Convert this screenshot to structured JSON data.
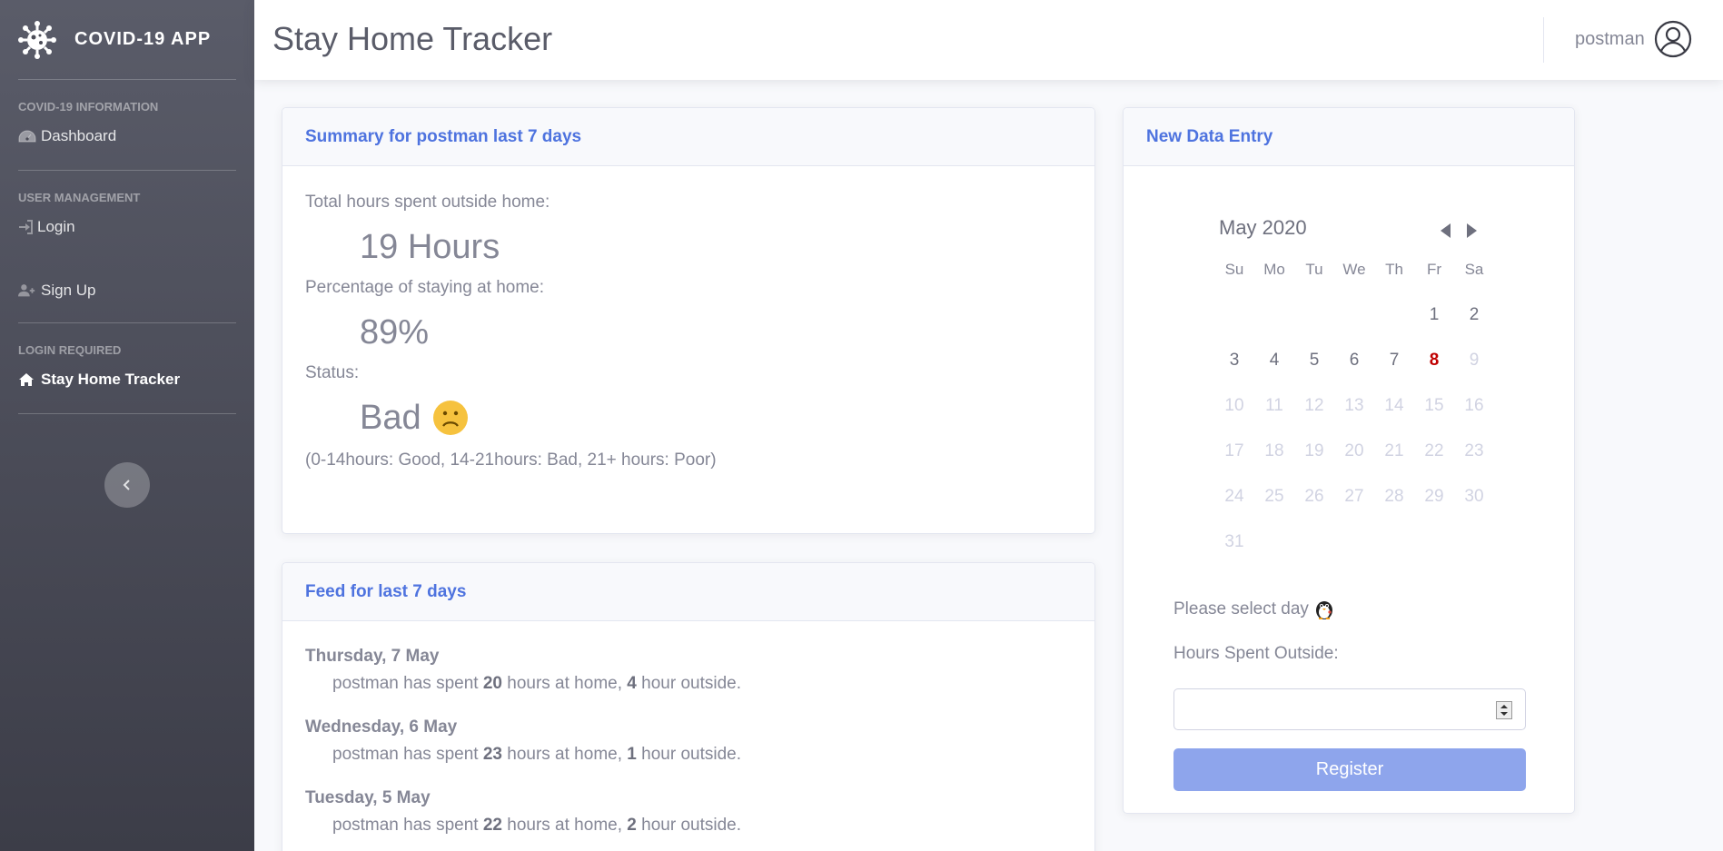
{
  "sidebar": {
    "brand": "COVID-19 APP",
    "sections": [
      {
        "heading": "COVID-19 INFORMATION",
        "items": [
          {
            "label": "Dashboard",
            "icon": "dashboard-icon"
          }
        ]
      },
      {
        "heading": "USER MANAGEMENT",
        "items": [
          {
            "label": "Login",
            "icon": "sign-in-icon"
          },
          {
            "label": "Sign Up",
            "icon": "user-plus-icon"
          }
        ]
      },
      {
        "heading": "LOGIN REQUIRED",
        "items": [
          {
            "label": "Stay Home Tracker",
            "icon": "home-icon",
            "active": true
          }
        ]
      }
    ]
  },
  "topbar": {
    "title": "Stay Home Tracker",
    "username": "postman"
  },
  "summary": {
    "header": "Summary for postman last 7 days",
    "hours_label": "Total hours spent outside home:",
    "hours_value": "19 Hours",
    "pct_label": "Percentage of staying at home:",
    "pct_value": "89%",
    "status_label": "Status:",
    "status_value": "Bad",
    "legend": "(0-14hours: Good, 14-21hours: Bad, 21+ hours: Poor)"
  },
  "feed": {
    "header": "Feed for last 7 days",
    "entries": [
      {
        "day": "Thursday, 7 May",
        "prefix": "postman has spent",
        "home": "20",
        "mid": "hours at home,",
        "outside": "4",
        "suffix": "hour outside."
      },
      {
        "day": "Wednesday, 6 May",
        "prefix": "postman has spent",
        "home": "23",
        "mid": "hours at home,",
        "outside": "1",
        "suffix": "hour outside."
      },
      {
        "day": "Tuesday, 5 May",
        "prefix": "postman has spent",
        "home": "22",
        "mid": "hours at home,",
        "outside": "2",
        "suffix": "hour outside."
      }
    ]
  },
  "entry": {
    "header": "New Data Entry",
    "calendar": {
      "month_label": "May 2020",
      "weekdays": [
        "Su",
        "Mo",
        "Tu",
        "We",
        "Th",
        "Fr",
        "Sa"
      ],
      "leading_blanks": 5,
      "days": 31,
      "today": 8,
      "last_enabled": 8
    },
    "prompt": "Please select day",
    "hours_label": "Hours Spent Outside:",
    "hours_value": "",
    "register_label": "Register"
  },
  "colors": {
    "primary": "#4e73df",
    "register_bg": "#8ea5ec",
    "today": "#c00000",
    "emoji": "#f6c23e"
  }
}
